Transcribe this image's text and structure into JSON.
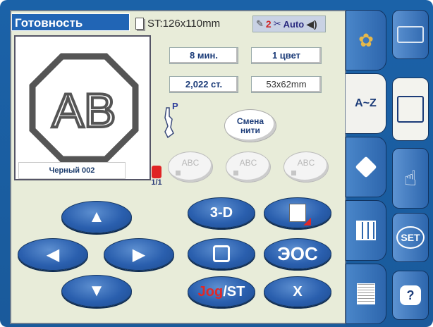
{
  "header": {
    "title": "Готовность",
    "stitch_info": "ST:126x110mm",
    "color_count": "2",
    "auto_label": "Auto"
  },
  "preview": {
    "design_text": "AB",
    "thread_label": "Черный 002",
    "spool_label": "1/1"
  },
  "info": {
    "time": "8 мин.",
    "colors": "1 цвет",
    "stitches": "2,022 ст.",
    "size": "53x62mm"
  },
  "presser_label": "P",
  "thread_change": {
    "line1": "Смена",
    "line2": "нити"
  },
  "abc_buttons": [
    "ABC",
    "ABC",
    "ABC"
  ],
  "controls": {
    "btn_3d": "3-D",
    "btn_jog_red": "Jog",
    "btn_jog_rest": "/ST",
    "btn_cancel": "X"
  },
  "sidebar": {
    "tab_az": "A~Z"
  },
  "modes": {
    "set": "SET",
    "help": "?"
  },
  "colors": {
    "accent": "#1b62a8",
    "screen_bg": "#e8ecd9",
    "button_blue": "#2a5fae",
    "thread_red": "#d02828"
  }
}
